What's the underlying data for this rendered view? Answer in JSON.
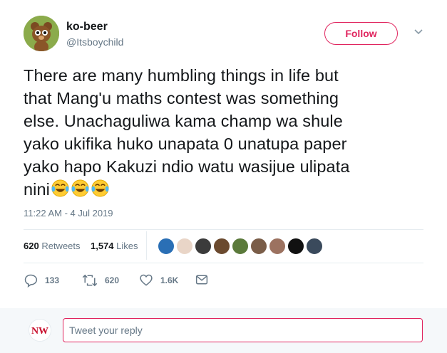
{
  "author": {
    "name": "ko-beer",
    "handle": "@Itsboychild",
    "avatar_icon": "cartoon-bear-avatar"
  },
  "follow_button": {
    "label": "Follow"
  },
  "menu": {
    "icon": "chevron-down-icon"
  },
  "tweet": {
    "lines": [
      "There are many humbling things in life but",
      "that Mang'u maths contest was something",
      "else. Unachaguliwa kama champ wa shule",
      "yako ukifika huko unapata 0 unatupa paper",
      "yako hapo Kakuzi ndio watu wasijue ulipata",
      "nini"
    ],
    "trailing_emoji": [
      "face-with-tears-of-joy",
      "face-with-tears-of-joy",
      "face-with-tears-of-joy"
    ],
    "timestamp": "11:22 AM - 4 Jul 2019"
  },
  "stats": {
    "retweets_count": "620",
    "retweets_label": "Retweets",
    "likes_count": "1,574",
    "likes_label": "Likes"
  },
  "liker_avatars": [
    {
      "icon": "avatar-1",
      "color": "#2a6fb5"
    },
    {
      "icon": "avatar-2",
      "color": "#c98a6a"
    },
    {
      "icon": "avatar-3",
      "color": "#3b3b3b"
    },
    {
      "icon": "avatar-4",
      "color": "#6b4a2f"
    },
    {
      "icon": "avatar-5",
      "color": "#5b7a3b"
    },
    {
      "icon": "avatar-6",
      "color": "#7a5d48"
    },
    {
      "icon": "avatar-7",
      "color": "#9c7260"
    },
    {
      "icon": "avatar-8",
      "color": "#111111"
    },
    {
      "icon": "avatar-9",
      "color": "#3a4a5c"
    }
  ],
  "actions": {
    "reply_count": "133",
    "retweet_count": "620",
    "like_count": "1.6K"
  },
  "reply_box": {
    "placeholder": "Tweet your reply",
    "avatar_text": "NW"
  },
  "colors": {
    "accent": "#e0245e",
    "muted": "#657786",
    "text": "#14171a"
  }
}
